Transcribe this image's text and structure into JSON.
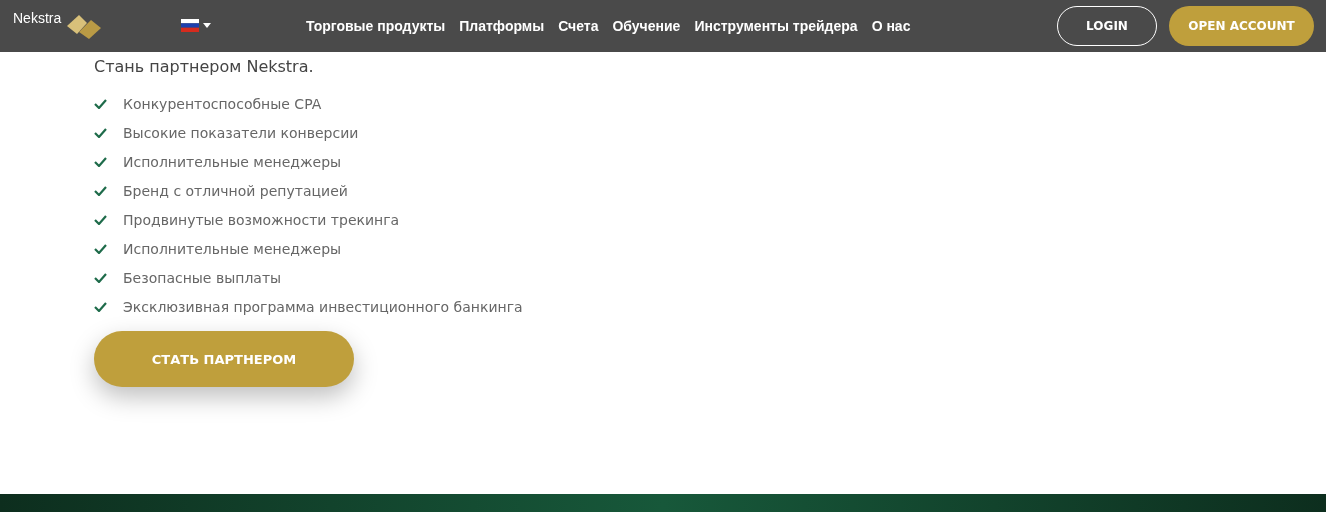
{
  "header": {
    "logo_text": "Nekstra",
    "nav": [
      "Торговые продукты",
      "Платформы",
      "Счета",
      "Обучение",
      "Инструменты трейдера",
      "О нас"
    ],
    "login": "LOGIN",
    "open_account": "OPEN ACCOUNT"
  },
  "content": {
    "subtitle": "Стань партнером Nekstra.",
    "benefits": [
      "Конкурентоспособные CPA",
      "Высокие показатели конверсии",
      "Исполнительные менеджеры",
      "Бренд с отличной репутацией",
      "Продвинутые возможности трекинга",
      "Исполнительные менеджеры",
      "Безопасные выплаты",
      "Эксклюзивная программа инвестиционного банкинга"
    ],
    "cta": "СТАТЬ ПАРТНЕРОМ"
  }
}
